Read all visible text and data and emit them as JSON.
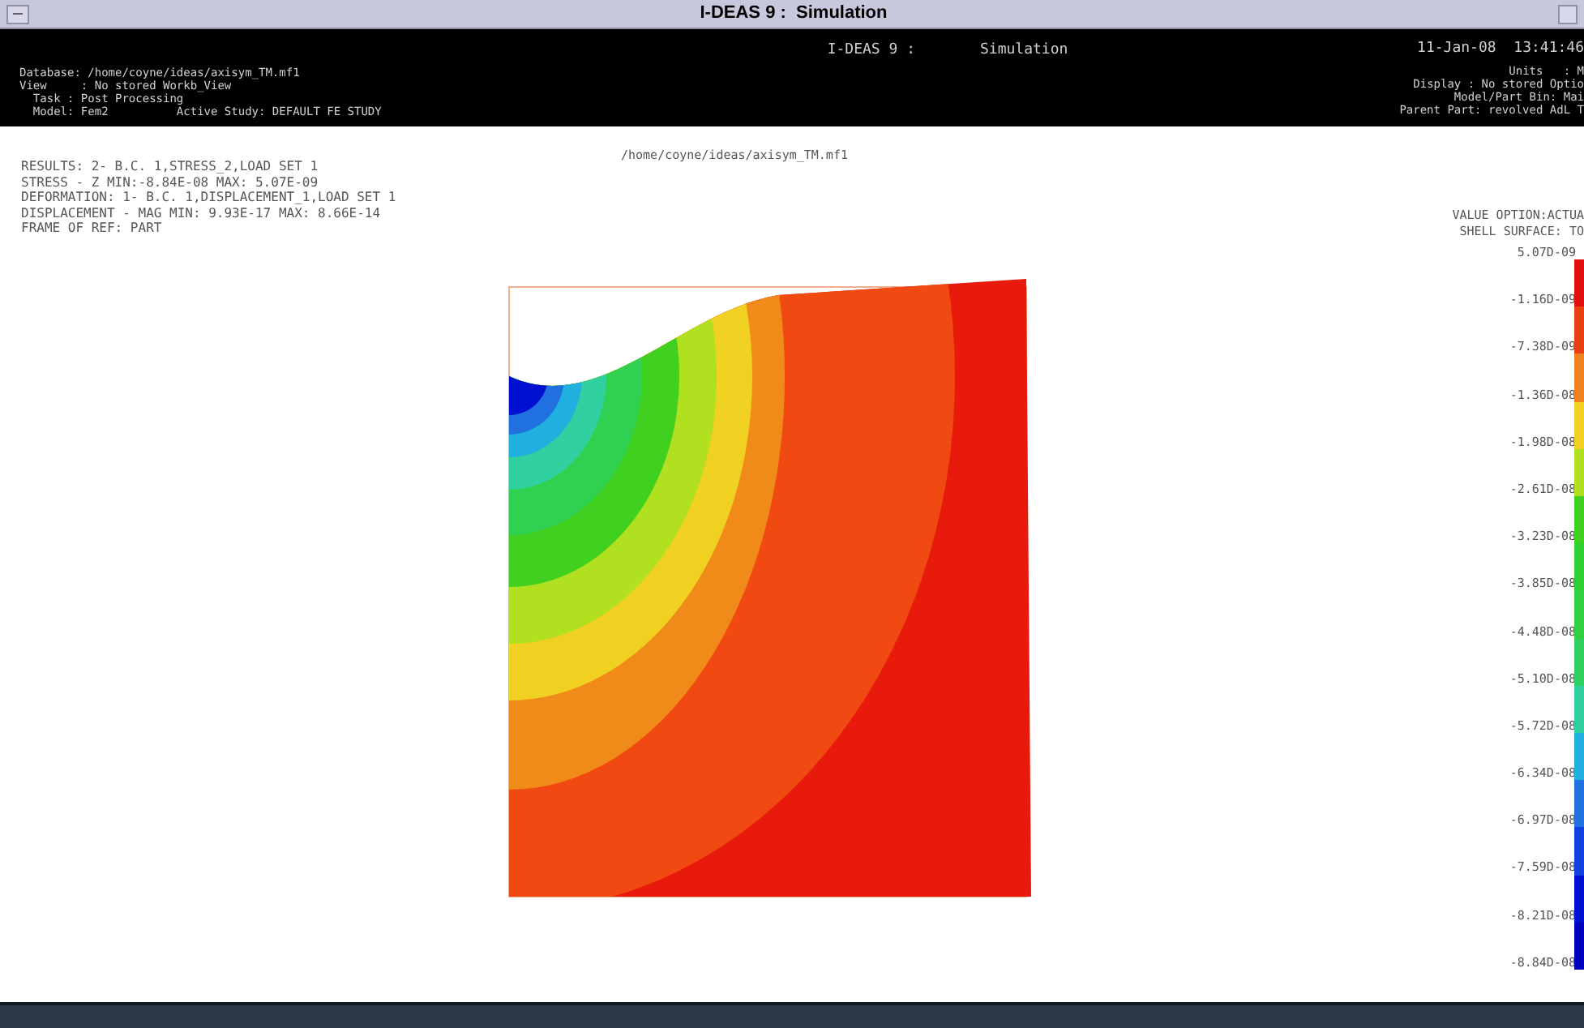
{
  "window": {
    "title": "I-DEAS 9 :  Simulation"
  },
  "header": {
    "app": "I-DEAS 9 :",
    "task_name": "Simulation",
    "datetime": "11-Jan-08  13:41:46",
    "left_lines": [
      "Database: /home/coyne/ideas/axisym_TM.mf1",
      "View     : No stored Workb_View",
      "  Task : Post Processing",
      "  Model: Fem2          Active Study: DEFAULT FE STUDY"
    ],
    "right_lines": [
      "Units   : M",
      "Display : No stored Optio",
      "Model/Part Bin: Mai",
      "Parent Part: revolved AdL T"
    ]
  },
  "file_path": "/home/coyne/ideas/axisym_TM.mf1",
  "results": [
    "RESULTS: 2- B.C. 1,STRESS_2,LOAD SET 1",
    "STRESS - Z MIN:-8.84E-08 MAX: 5.07E-09",
    "DEFORMATION: 1- B.C. 1,DISPLACEMENT_1,LOAD SET 1",
    "DISPLACEMENT - MAG MIN: 9.93E-17 MAX: 8.66E-14",
    "FRAME OF REF: PART"
  ],
  "legend": {
    "lines": [
      "VALUE OPTION:ACTUA",
      "SHELL SURFACE: TO"
    ],
    "labels": [
      "5.07D-09",
      "-1.16D-09",
      "-7.38D-09",
      "-1.36D-08",
      "-1.98D-08",
      "-2.61D-08",
      "-3.23D-08",
      "-3.85D-08",
      "-4.48D-08",
      "-5.10D-08",
      "-5.72D-08",
      "-6.34D-08",
      "-6.97D-08",
      "-7.59D-08",
      "-8.21D-08",
      "-8.84D-08"
    ],
    "bands": [
      {
        "color": "#e01010"
      },
      {
        "color": "#e84010"
      },
      {
        "color": "#f08020"
      },
      {
        "color": "#f0d020"
      },
      {
        "color": "#b0e020"
      },
      {
        "color": "#40d020"
      },
      {
        "color": "#30d030"
      },
      {
        "color": "#30d040"
      },
      {
        "color": "#30d060"
      },
      {
        "color": "#30d0a0"
      },
      {
        "color": "#20b0e0"
      },
      {
        "color": "#2070e0"
      },
      {
        "color": "#1040e0"
      },
      {
        "color": "#0010d0"
      },
      {
        "color": "#0000c0"
      }
    ]
  }
}
